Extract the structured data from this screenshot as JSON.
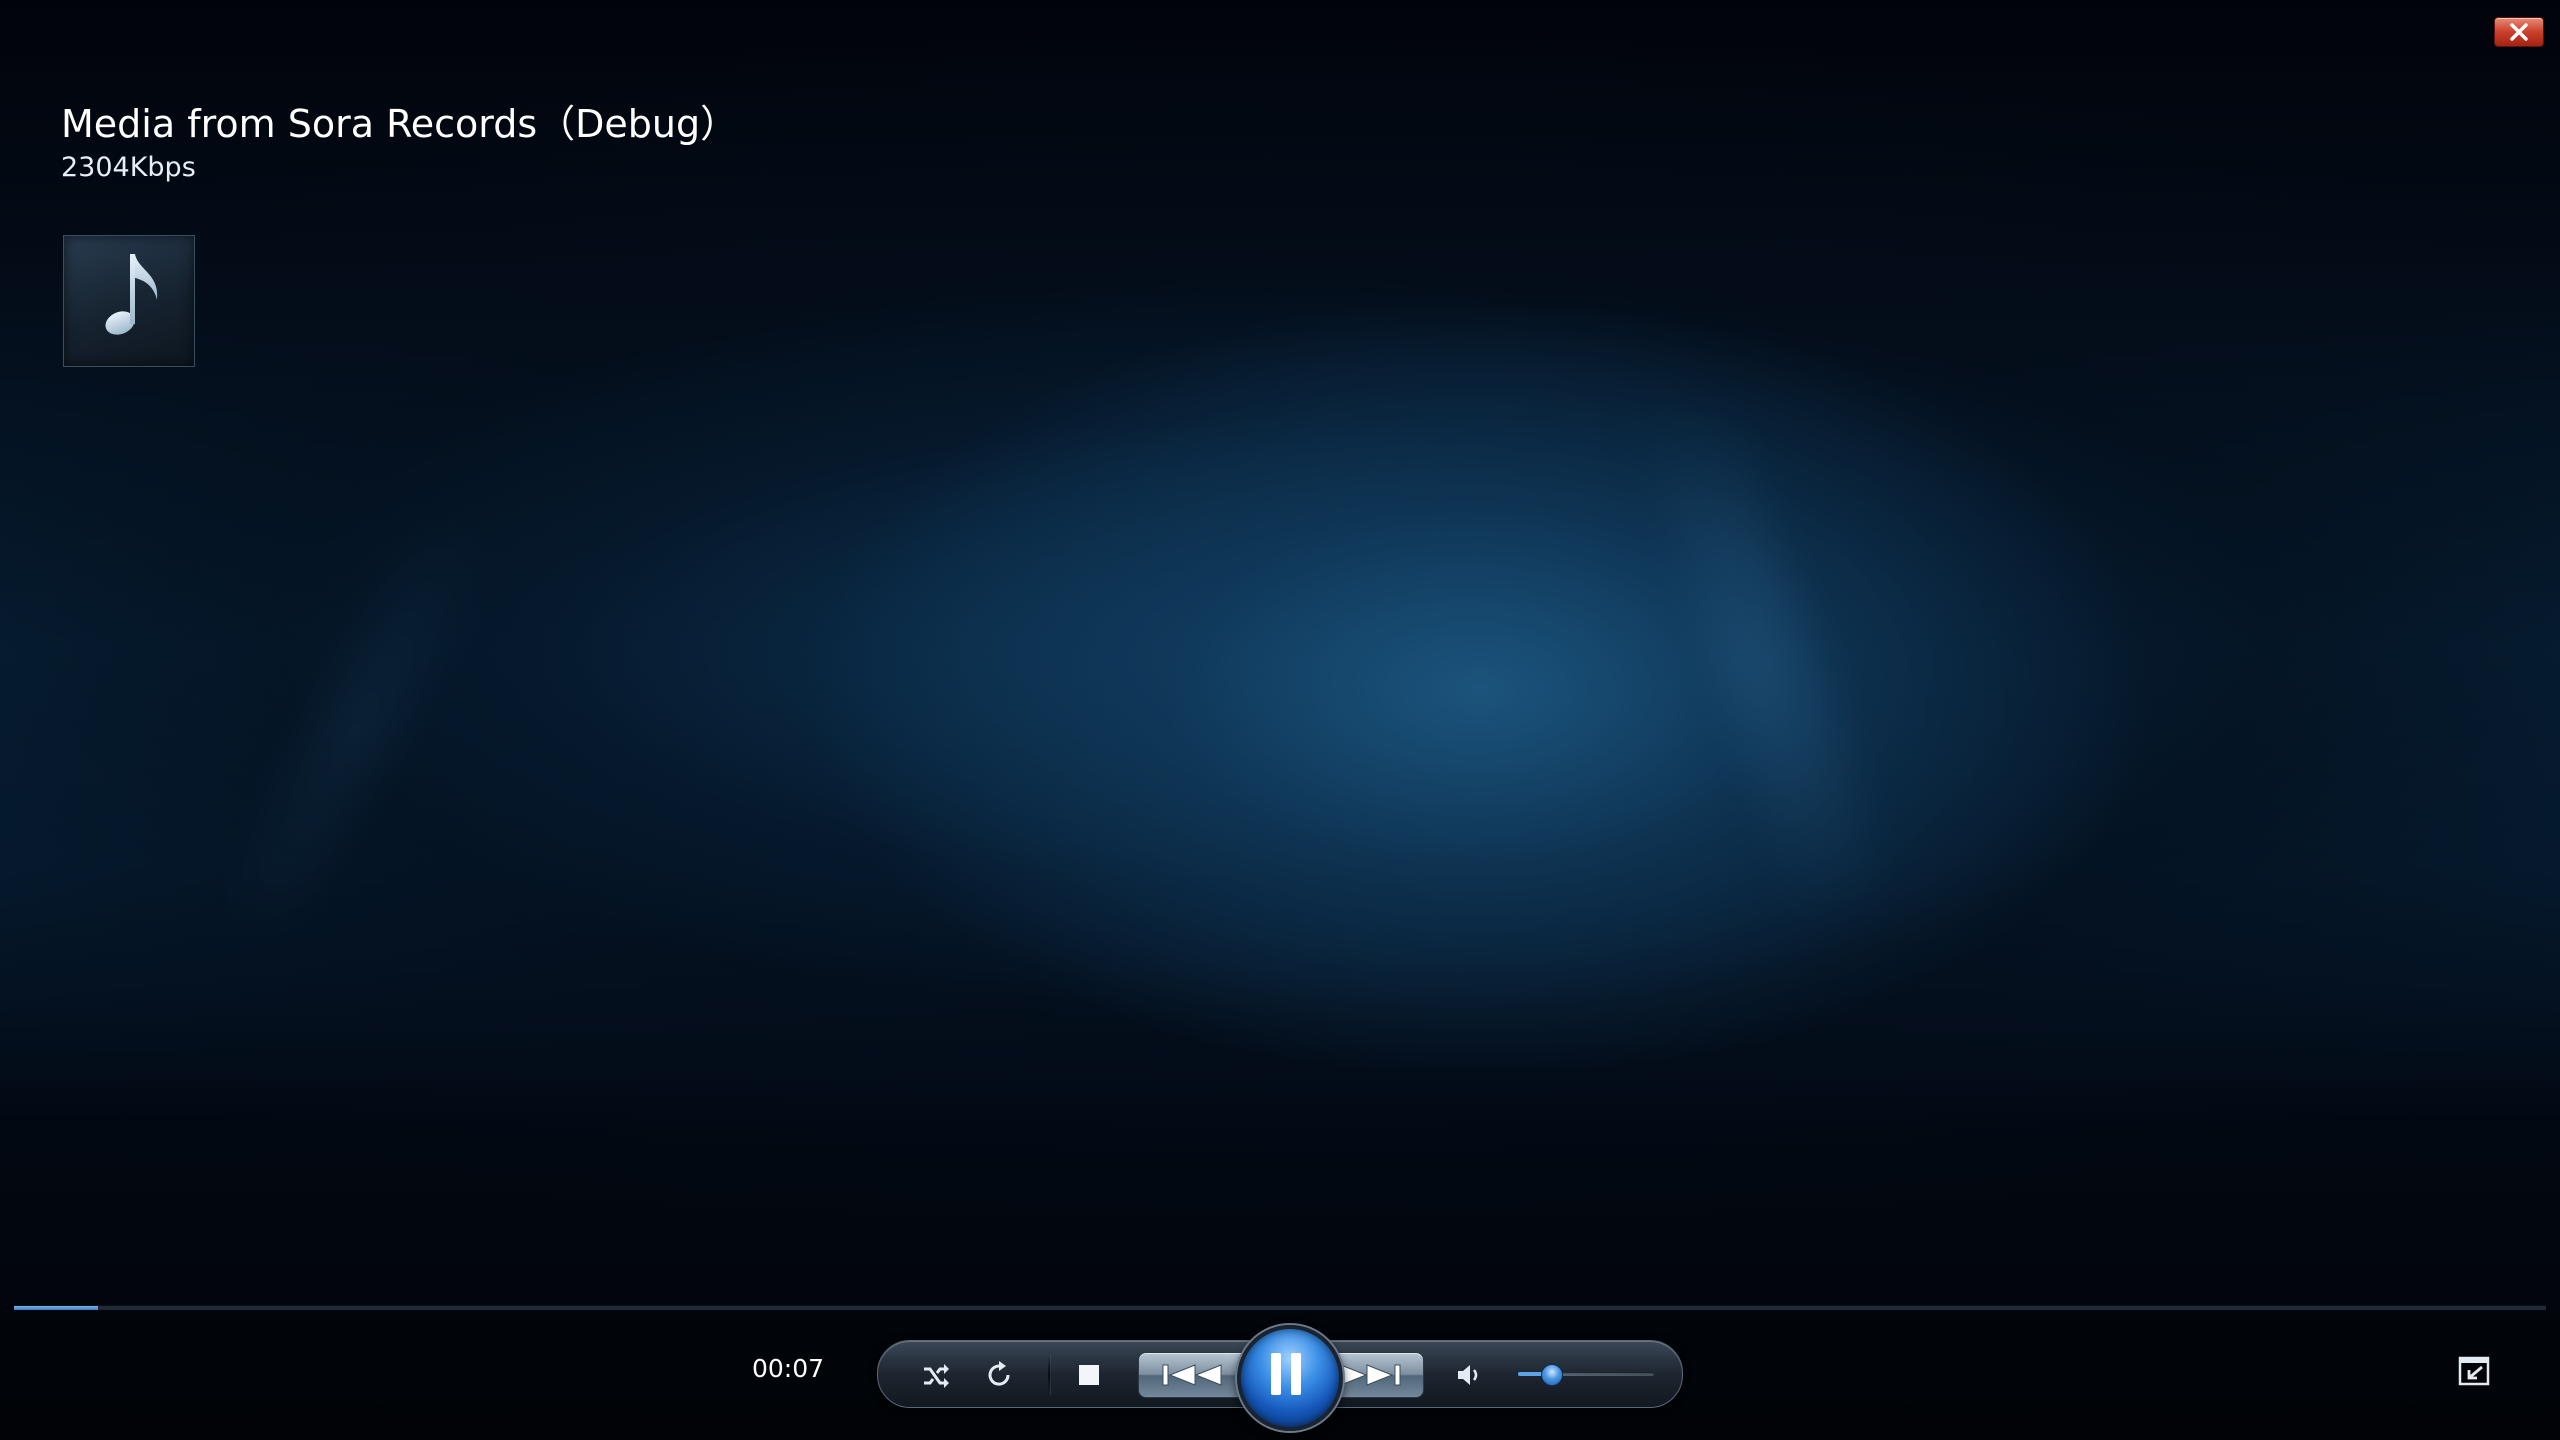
{
  "window": {
    "close_label": "Close"
  },
  "now_playing": {
    "title": "Media from Sora Records（Debug）",
    "bitrate": "2304Kbps"
  },
  "album_art": {
    "icon": "music-note-icon"
  },
  "playback": {
    "elapsed": "00:07",
    "progress_fraction": 0.033,
    "volume_fraction": 0.24
  },
  "controls": {
    "shuffle": "shuffle-icon",
    "repeat": "repeat-icon",
    "stop": "stop-icon",
    "previous": "previous-icon",
    "pause": "pause-icon",
    "next": "next-icon",
    "mute": "speaker-icon",
    "switch_to_library": "switch-view-icon"
  },
  "colors": {
    "accent_blue": "#3a8ee6",
    "close_red": "#c9402b"
  }
}
